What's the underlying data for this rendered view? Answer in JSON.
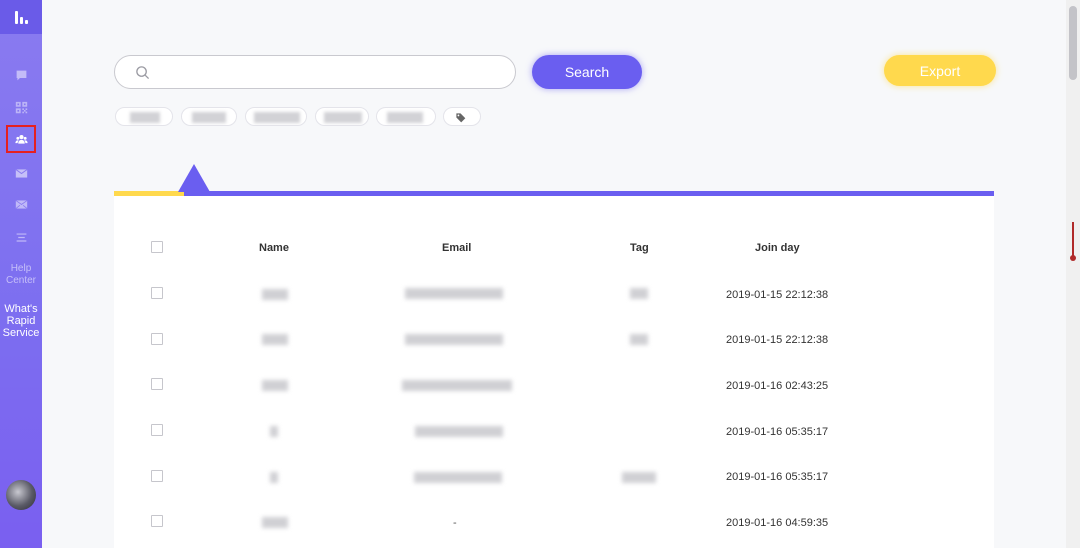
{
  "sidebar": {
    "help": "Help\nCenter",
    "whats": "What's\nRapid\nService",
    "nav": [
      "chat-icon",
      "qr-icon",
      "users-icon",
      "mail-icon",
      "send-mail-icon",
      "menu-icon"
    ]
  },
  "search": {
    "value": "",
    "placeholder": "",
    "button_label": "Search"
  },
  "export_label": "Export",
  "table": {
    "headers": {
      "name": "Name",
      "email": "Email",
      "tag": "Tag",
      "join_day": "Join day"
    },
    "rows": [
      {
        "join_day": "2019-01-15 22:12:38"
      },
      {
        "join_day": "2019-01-15 22:12:38"
      },
      {
        "join_day": "2019-01-16 02:43:25"
      },
      {
        "join_day": "2019-01-16 05:35:17"
      },
      {
        "join_day": "2019-01-16 05:35:17"
      },
      {
        "email": "-",
        "join_day": "2019-01-16 04:59:35"
      }
    ]
  },
  "colors": {
    "accent": "#6a5ef0",
    "export": "#ffd94d",
    "sidebar": "#7d6ff0"
  }
}
